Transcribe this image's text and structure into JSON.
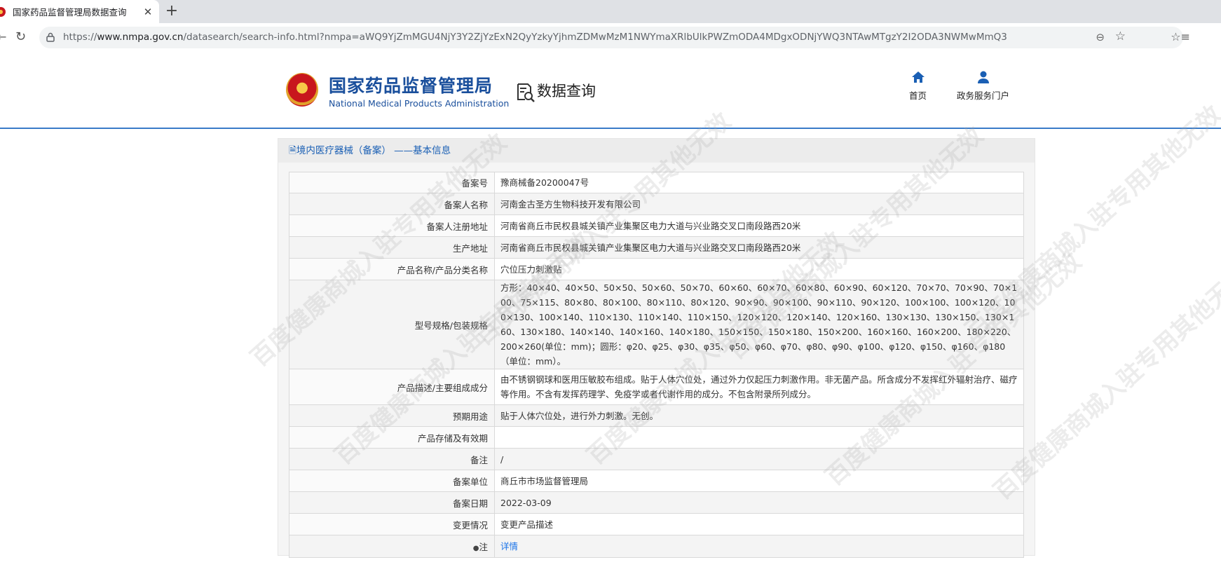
{
  "browser": {
    "tab_title": "国家药品监督管理局数据查询",
    "url_prefix": "https://",
    "url_domain": "www.nmpa.gov.cn",
    "url_path": "/datasearch/search-info.html?nmpa=aWQ9YjZmMGU4NjY3Y2ZjYzExN2QyYzkyYjhmZDMwMzM1NWYmaXRlbUlkPWZmODA4MDgxODNjYWQ3NTAwMTgzY2I2ODA3NWMwMmQ3"
  },
  "header": {
    "org_cn": "国家药品监督管理局",
    "org_en": "National Medical Products Administration",
    "section_title": "数据查询",
    "nav_home": "首页",
    "nav_portal": "政务服务门户"
  },
  "panel": {
    "title": "境内医疗器械（备案） ——基本信息"
  },
  "rows": [
    {
      "key": "备案号",
      "value": "豫商械备20200047号"
    },
    {
      "key": "备案人名称",
      "value": "河南金古圣方生物科技开发有限公司"
    },
    {
      "key": "备案人注册地址",
      "value": "河南省商丘市民权县城关镇产业集聚区电力大道与兴业路交叉口南段路西20米"
    },
    {
      "key": "生产地址",
      "value": "河南省商丘市民权县城关镇产业集聚区电力大道与兴业路交叉口南段路西20米"
    },
    {
      "key": "产品名称/产品分类名称",
      "value": "穴位压力刺激贴"
    },
    {
      "key": "型号规格/包装规格",
      "value": "方形：40×40、40×50、50×50、50×60、50×70、60×60、60×70、60×80、60×90、60×120、70×70、70×90、70×100、75×115、80×80、80×100、80×110、80×120、90×90、90×100、90×110、90×120、100×100、100×120、100×130、100×140、110×130、110×140、110×150、120×120、120×140、120×160、130×130、130×150、130×160、130×180、140×140、140×160、140×180、150×150、150×180、150×200、160×160、160×200、180×220、200×260(单位：mm)；圆形：φ20、φ25、φ30、φ35、φ50、φ60、φ70、φ80、φ90、φ100、φ120、φ150、φ160、φ180（单位：mm）。"
    },
    {
      "key": "产品描述/主要组成成分",
      "value": "由不锈钢钢球和医用压敏胶布组成。贴于人体穴位处，通过外力仅起压力刺激作用。非无菌产品。所含成分不发挥红外辐射治疗、磁疗等作用。不含有发挥药理学、免疫学或者代谢作用的成分。不包含附录所列成分。"
    },
    {
      "key": "预期用途",
      "value": "贴于人体穴位处，进行外力刺激。无创。"
    },
    {
      "key": "产品存储及有效期",
      "value": ""
    },
    {
      "key": "备注",
      "value": "/"
    },
    {
      "key": "备案单位",
      "value": "商丘市市场监督管理局"
    },
    {
      "key": "备案日期",
      "value": "2022-03-09"
    },
    {
      "key": "变更情况",
      "value": "变更产品描述"
    },
    {
      "key": "注",
      "value": "详情"
    }
  ],
  "watermark_text": "百度健康商城入驻专用其他无效"
}
